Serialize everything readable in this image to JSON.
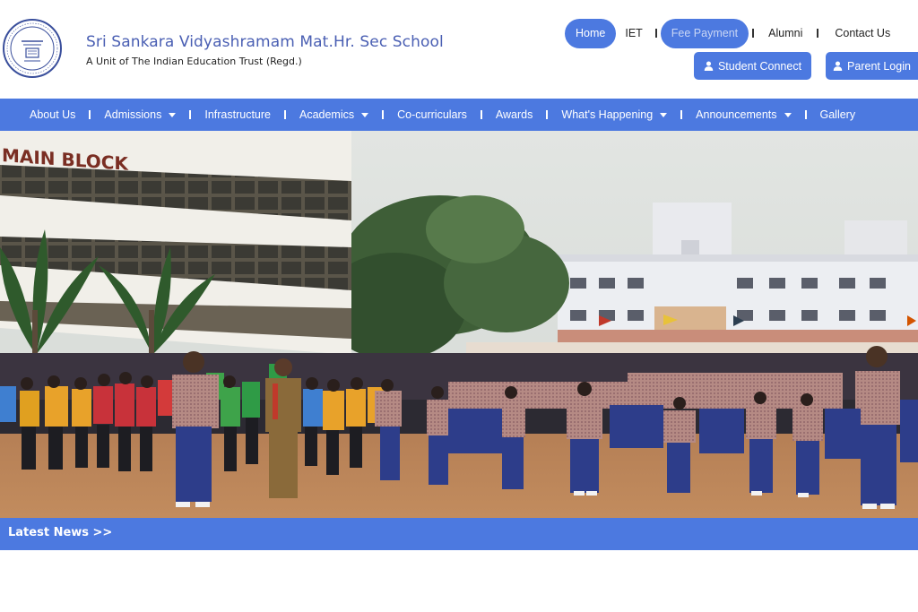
{
  "header": {
    "school_name": "Sri Sankara Vidyashramam Mat.Hr. Sec School",
    "subtitle": "A Unit of The Indian Education Trust (Regd.)"
  },
  "topnav": {
    "home": "Home",
    "iet": "IET",
    "fee_payment": "Fee Payment",
    "alumni": "Alumni",
    "contact": "Contact Us"
  },
  "buttons": {
    "student_connect": "Student Connect",
    "parent_login": "Parent Login"
  },
  "mainnav": {
    "items": [
      {
        "label": "About Us",
        "dropdown": false
      },
      {
        "label": "Admissions",
        "dropdown": true
      },
      {
        "label": "Infrastructure",
        "dropdown": false
      },
      {
        "label": "Academics",
        "dropdown": true
      },
      {
        "label": "Co-curriculars",
        "dropdown": false
      },
      {
        "label": "Awards",
        "dropdown": false
      },
      {
        "label": "What's Happening",
        "dropdown": true
      },
      {
        "label": "Announcements",
        "dropdown": true
      },
      {
        "label": "Gallery",
        "dropdown": false
      }
    ]
  },
  "hero": {
    "building_sign": "MAIN BLOCK"
  },
  "news": {
    "label": "Latest News >>"
  },
  "colors": {
    "accent": "#4c79e0",
    "title": "#4a5fb3"
  }
}
